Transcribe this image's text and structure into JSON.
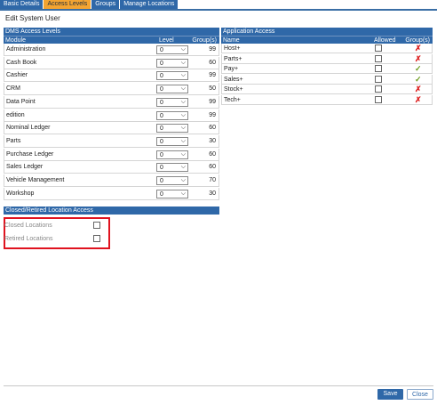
{
  "tabs": [
    {
      "label": "Basic Details",
      "active": false
    },
    {
      "label": "Access Levels",
      "active": true
    },
    {
      "label": "Groups",
      "active": false
    },
    {
      "label": "Manage Locations",
      "active": false
    }
  ],
  "page_title": "Edit System User",
  "dms": {
    "title": "DMS Access Levels",
    "col_module": "Module",
    "col_level": "Level",
    "col_groups": "Group(s)",
    "rows": [
      {
        "module": "Administration",
        "level": "0",
        "groups": "99"
      },
      {
        "module": "Cash Book",
        "level": "0",
        "groups": "60"
      },
      {
        "module": "Cashier",
        "level": "0",
        "groups": "99"
      },
      {
        "module": "CRM",
        "level": "0",
        "groups": "50"
      },
      {
        "module": "Data Point",
        "level": "0",
        "groups": "99"
      },
      {
        "module": "edition",
        "level": "0",
        "groups": "99"
      },
      {
        "module": "Nominal Ledger",
        "level": "0",
        "groups": "60"
      },
      {
        "module": "Parts",
        "level": "0",
        "groups": "30"
      },
      {
        "module": "Purchase Ledger",
        "level": "0",
        "groups": "60"
      },
      {
        "module": "Sales Ledger",
        "level": "0",
        "groups": "60"
      },
      {
        "module": "Vehicle Management",
        "level": "0",
        "groups": "70"
      },
      {
        "module": "Workshop",
        "level": "0",
        "groups": "30"
      }
    ]
  },
  "app": {
    "title": "Application Access",
    "col_name": "Name",
    "col_allowed": "Allowed",
    "col_groups": "Group(s)",
    "rows": [
      {
        "name": "Host+",
        "allowed": false,
        "group_icon": "cross-icon"
      },
      {
        "name": "Parts+",
        "allowed": false,
        "group_icon": "cross-icon"
      },
      {
        "name": "Pay+",
        "allowed": false,
        "group_icon": "check-icon"
      },
      {
        "name": "Sales+",
        "allowed": false,
        "group_icon": "check-icon"
      },
      {
        "name": "Stock+",
        "allowed": false,
        "group_icon": "cross-icon"
      },
      {
        "name": "Tech+",
        "allowed": false,
        "group_icon": "cross-icon"
      }
    ]
  },
  "closed_access": {
    "title": "Closed/Retired Location Access",
    "rows": [
      {
        "label": "Closed Locations",
        "checked": false
      },
      {
        "label": "Retired Locations",
        "checked": false
      }
    ]
  },
  "footer": {
    "save_label": "Save",
    "close_label": "Close"
  },
  "colors": {
    "header_blue": "#2f68a8",
    "active_tab": "#f3a431",
    "cross": "#dd2222",
    "check": "#6a9a1a",
    "highlight_box": "#e0131f"
  }
}
